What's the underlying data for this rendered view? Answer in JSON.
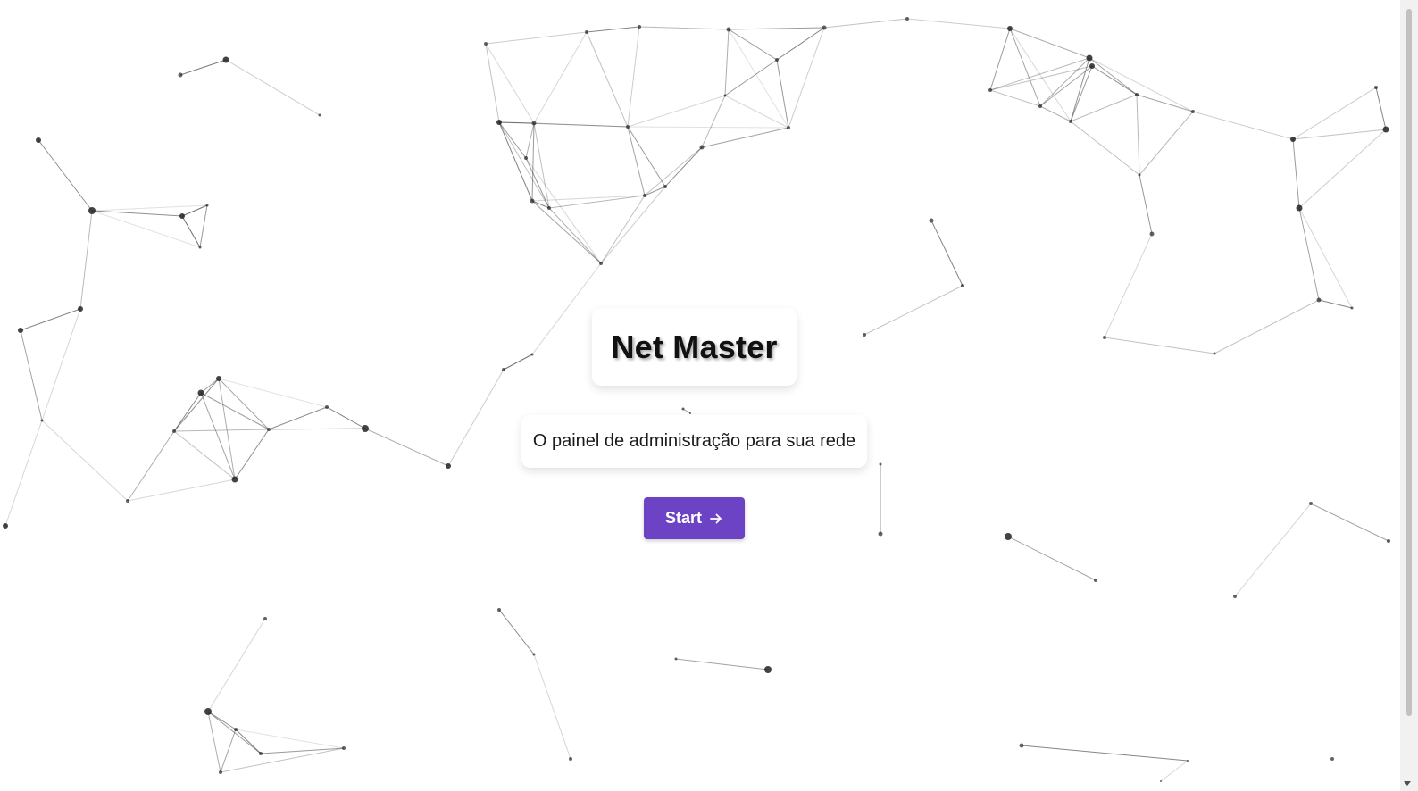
{
  "hero": {
    "title": "Net Master",
    "subtitle": "O painel de administração para sua rede",
    "start_label": "Start",
    "start_icon": "arrow-right-icon"
  },
  "background": {
    "style": "particle-network",
    "node_color": "#222222",
    "line_color": "#444444"
  },
  "colors": {
    "accent": "#6c43c4",
    "background": "#ffffff"
  }
}
